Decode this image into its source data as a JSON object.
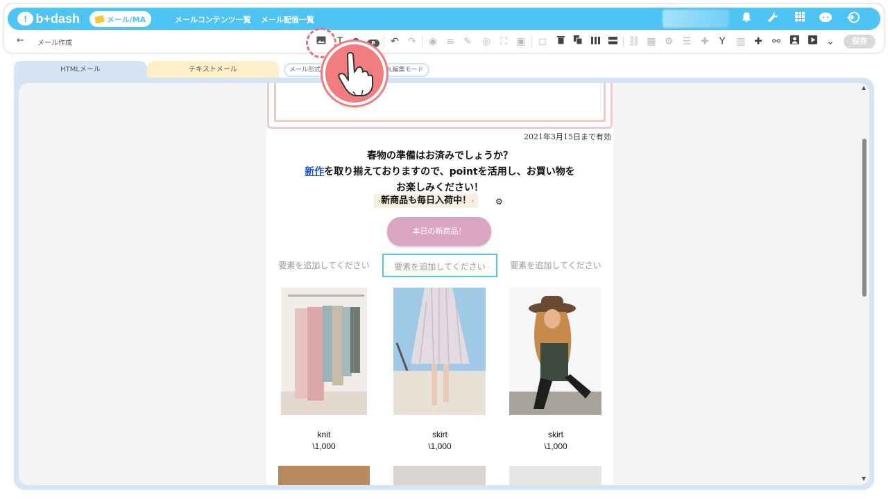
{
  "header": {
    "logo_text": "b+dash",
    "module": "メール/MA",
    "nav": [
      "メールコンテンツ一覧",
      "メール配信一覧"
    ]
  },
  "toolbar": {
    "back": "←",
    "page_title": "メール作成",
    "save_label": "保存",
    "block_label": "B"
  },
  "tabs": {
    "html": "HTMLメール",
    "text": "テキストメール",
    "mode1": "メール形式",
    "mode2": "ML編集モード"
  },
  "email": {
    "valid_until": "2021年3月15日まで有効",
    "headline_line1": "春物の準備はお済みでしょうか？",
    "headline_link": "新作",
    "headline_line2_rest": "を取り揃えておりますので、pointを活用し、お買い物を",
    "headline_line3": "お楽しみください！",
    "sub_headline": "新商品も毎日入荷中！",
    "cta_label": "本日の新商品！",
    "placeholders": [
      "要素を追加してください",
      "要素を追加してください",
      "要素を追加してください"
    ],
    "products": [
      {
        "name": "knit",
        "price": "\\1,000"
      },
      {
        "name": "skirt",
        "price": "\\1,000"
      },
      {
        "name": "skirt",
        "price": "\\1,000"
      }
    ]
  },
  "colors": {
    "header_blue": "#4ec4f5",
    "cta_pink": "#d9a5c1",
    "pointer_red": "#f27d80",
    "tab_html": "#d5e5f3",
    "tab_text": "#fdf0c8"
  }
}
